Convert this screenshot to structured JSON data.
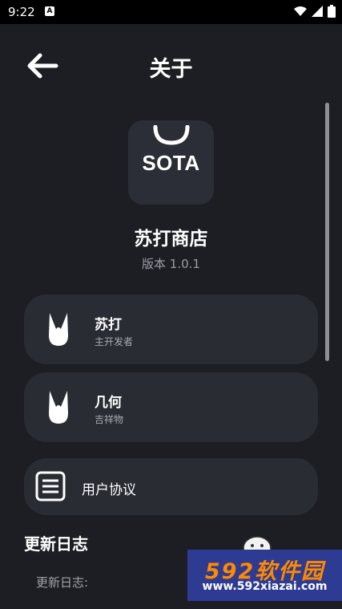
{
  "status_bar": {
    "time": "9:22",
    "a_glyph": "A"
  },
  "header": {
    "title": "关于",
    "back_icon": "arrow-left-icon"
  },
  "app": {
    "logo_text": "SOTA",
    "name": "苏打商店",
    "version": "版本 1.0.1"
  },
  "cards": [
    {
      "title": "苏打",
      "subtitle": "主开发者",
      "icon": "tooth-icon"
    },
    {
      "title": "几何",
      "subtitle": "吉祥物",
      "icon": "tooth-icon"
    },
    {
      "title": "用户协议",
      "icon": "document-icon"
    }
  ],
  "changelog": {
    "section_title": "更新日志",
    "label": "更新日志:"
  },
  "watermark": {
    "line1": "592软件园",
    "line2": "www.592xiazai.com"
  },
  "colors": {
    "background": "#1c1e24",
    "card": "#2a2c34",
    "muted_text": "#9b9ea5",
    "watermark_bg": "#2e3b93",
    "watermark_accent": "#ff8a00"
  }
}
